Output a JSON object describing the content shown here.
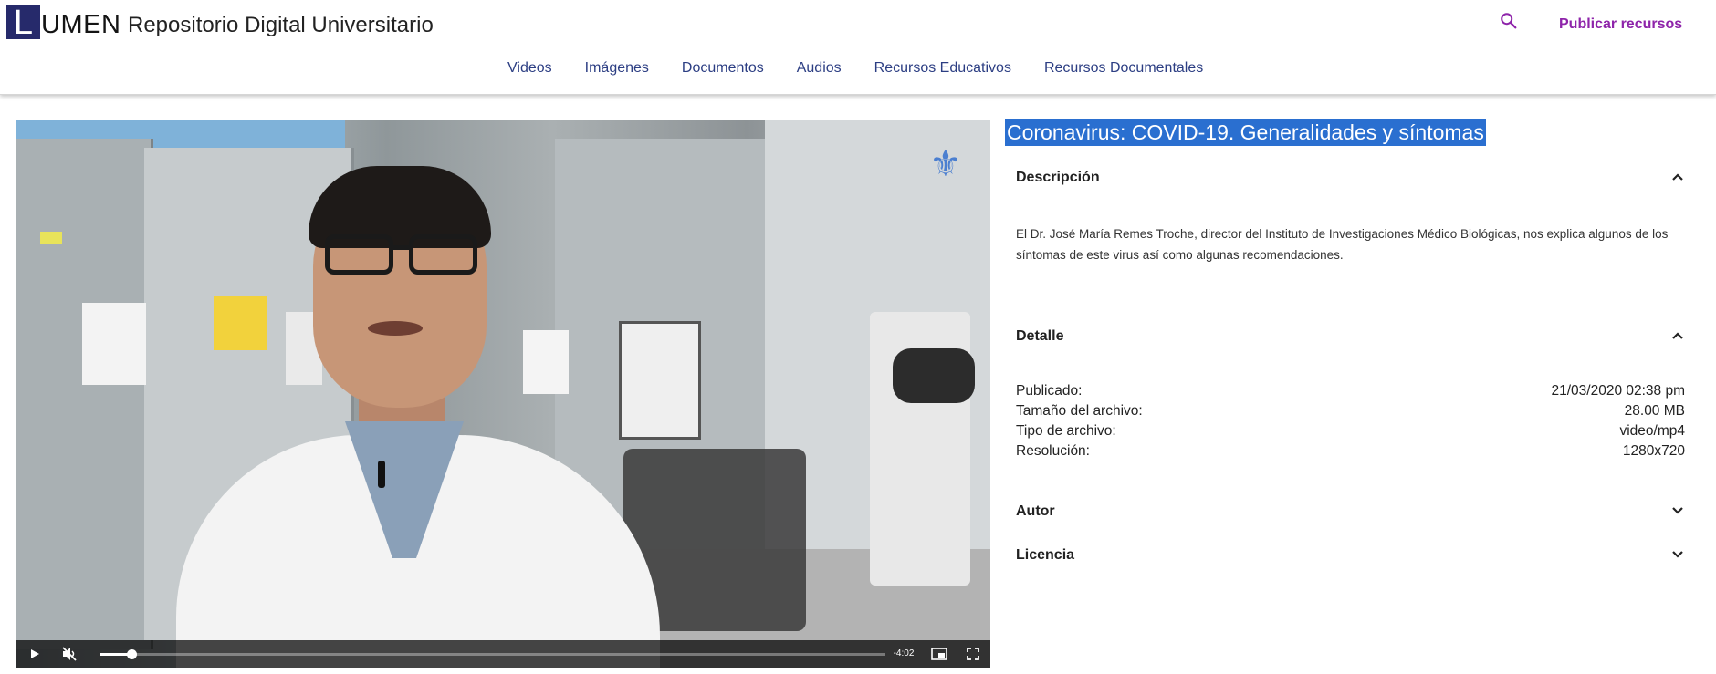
{
  "header": {
    "logo_initial": "L",
    "logo_rest": "UMEN",
    "site_title": "Repositorio Digital Universitario",
    "search_icon": "search-icon",
    "publish_label": "Publicar recursos",
    "accent": "#8e24aa",
    "nav": [
      {
        "label": "Videos"
      },
      {
        "label": "Imágenes"
      },
      {
        "label": "Documentos"
      },
      {
        "label": "Audios"
      },
      {
        "label": "Recursos Educativos"
      },
      {
        "label": "Recursos Documentales"
      }
    ]
  },
  "video": {
    "time_remaining": "-4:02",
    "progress_fraction": 0.04,
    "muted": true,
    "controls": {
      "play_icon": "play-icon",
      "mute_icon": "volume-muted-icon",
      "pip_icon": "picture-in-picture-icon",
      "fullscreen_icon": "fullscreen-icon"
    }
  },
  "resource": {
    "title": "Coronavirus: COVID-19. Generalidades y síntomas",
    "sections": {
      "descripcion": {
        "label": "Descripción",
        "expanded": true,
        "text": "El Dr. José María Remes Troche, director del Instituto de Investigaciones Médico Biológicas, nos explica algunos de los síntomas de este virus así como algunas recomendaciones."
      },
      "detalle": {
        "label": "Detalle",
        "expanded": true,
        "rows": [
          {
            "key": "Publicado:",
            "value": "21/03/2020 02:38 pm"
          },
          {
            "key": "Tamaño del archivo:",
            "value": "28.00 MB"
          },
          {
            "key": "Tipo de archivo:",
            "value": "video/mp4"
          },
          {
            "key": "Resolución:",
            "value": "1280x720"
          }
        ]
      },
      "autor": {
        "label": "Autor",
        "expanded": false
      },
      "licencia": {
        "label": "Licencia",
        "expanded": false
      }
    }
  }
}
